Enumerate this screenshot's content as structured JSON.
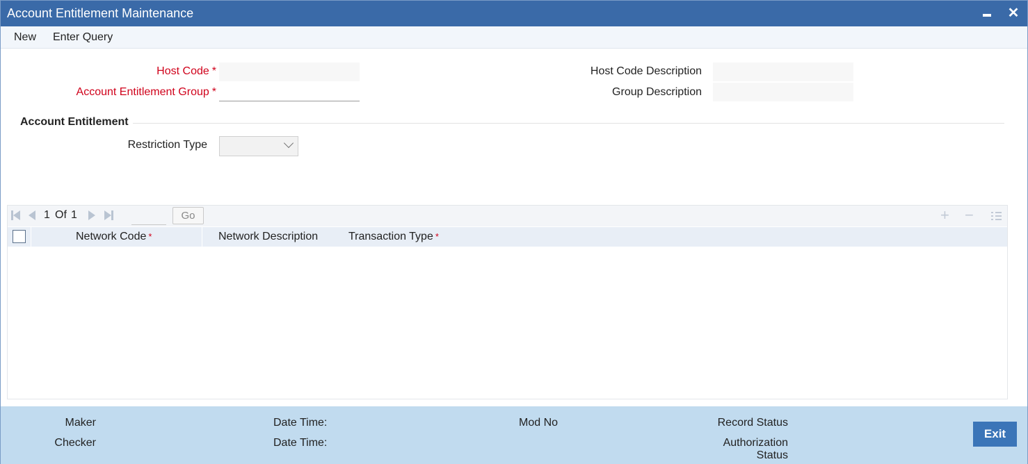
{
  "window": {
    "title": "Account Entitlement Maintenance",
    "minimize_icon": "minimize-icon",
    "close_icon": "close-icon",
    "close_glyph": "✕"
  },
  "toolbar": {
    "new_label": "New",
    "enter_query_label": "Enter Query"
  },
  "form": {
    "host_code_label": "Host Code",
    "host_code_value": "",
    "account_entitlement_group_label": "Account Entitlement Group",
    "account_entitlement_group_value": "",
    "host_code_description_label": "Host Code Description",
    "host_code_description_value": "",
    "group_description_label": "Group Description",
    "group_description_value": "",
    "required_marker": "*"
  },
  "account_entitlement": {
    "section_title": "Account Entitlement",
    "restriction_type_label": "Restriction Type",
    "restriction_type_value": ""
  },
  "grid": {
    "pager": {
      "current_page": "1",
      "of_label": "Of",
      "total_pages": "1",
      "go_label": "Go"
    },
    "columns": [
      {
        "label": "Network Code",
        "required": true
      },
      {
        "label": "Network Description",
        "required": false
      },
      {
        "label": "Transaction Type",
        "required": true
      }
    ],
    "rows": [],
    "required_marker": "*",
    "add_glyph": "+",
    "remove_glyph": "−"
  },
  "footer": {
    "maker_label": "Maker",
    "checker_label": "Checker",
    "date_time_label_1": "Date Time:",
    "date_time_label_2": "Date Time:",
    "mod_no_label": "Mod No",
    "record_status_label": "Record Status",
    "authorization_status_line1": "Authorization",
    "authorization_status_line2": "Status",
    "exit_label": "Exit"
  },
  "colors": {
    "titlebar": "#3a6aa8",
    "required": "#d0021b",
    "footer": "#c1dbef",
    "exit_button": "#3b75b8"
  }
}
